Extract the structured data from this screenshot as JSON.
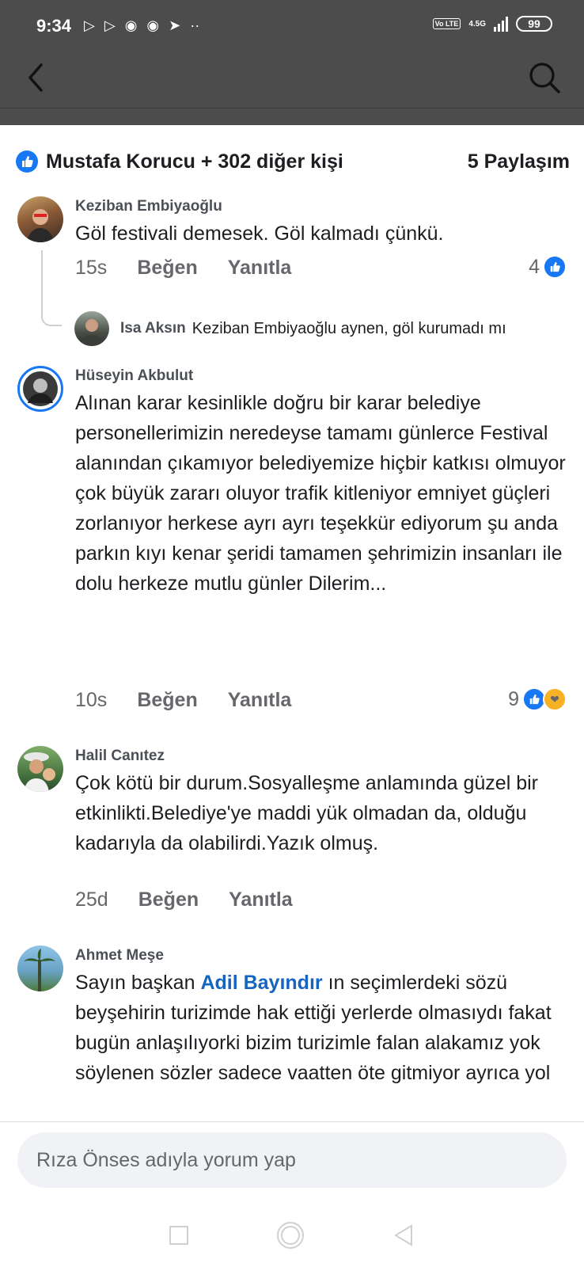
{
  "status_bar": {
    "time": "9:34",
    "icons": [
      "play-icon",
      "play-icon",
      "chrome-icon",
      "chrome-icon",
      "telegram-icon",
      "more-dots-icon"
    ],
    "volte": "Vo LTE",
    "network": "4.5G",
    "battery": "99"
  },
  "summary": {
    "reactors": "Mustafa Korucu + 302 diğer kişi",
    "shares": "5 Paylaşım"
  },
  "comments": [
    {
      "author": "Keziban Embiyaoğlu",
      "text": "Göl festivali demesek. Göl kalmadı çünkü.",
      "time": "15s",
      "like_label": "Beğen",
      "reply_label": "Yanıtla",
      "reactions": "4",
      "reply": {
        "author": "Isa Aksın",
        "text": "Keziban Embiyaoğlu aynen, göl kurumadı mı"
      }
    },
    {
      "author": "Hüseyin Akbulut",
      "text": "Alınan karar kesinlikle doğru bir karar belediye personellerimizin neredeyse tamamı günlerce Festival alanından çıkamıyor belediyemize hiçbir katkısı olmuyor çok büyük zararı oluyor trafik kitleniyor emniyet güçleri zorlanıyor herkese ayrı ayrı teşekkür ediyorum şu anda parkın kıyı kenar şeridi tamamen şehrimizin insanları ile dolu herkeze mutlu günler Dilerim...",
      "time": "10s",
      "like_label": "Beğen",
      "reply_label": "Yanıtla",
      "reactions": "9"
    },
    {
      "author": "Halil Canıtez",
      "text": "Çok kötü bir durum.Sosyalleşme anlamında güzel bir etkinlikti.Belediye'ye maddi yük olmadan da, olduğu kadarıyla da olabilirdi.Yazık olmuş.",
      "time": "25d",
      "like_label": "Beğen",
      "reply_label": "Yanıtla"
    },
    {
      "author": "Ahmet Meşe",
      "text_before": "Sayın başkan ",
      "mention": "Adil Bayındır",
      "text_after": " ın seçimlerdeki sözü beyşehirin turizimde hak ettiği yerlerde olmasıydı fakat bugün anlaşılıyorki bizim turizimle falan alakamız yok söylenen sözler sadece vaatten öte gitmiyor ayrıca yol"
    }
  ],
  "composer": {
    "placeholder": "Rıza Önses adıyla yorum yap"
  },
  "colors": {
    "header_bg": "#4c4c4c",
    "accent": "#1877f2",
    "mention": "#1565c0"
  }
}
